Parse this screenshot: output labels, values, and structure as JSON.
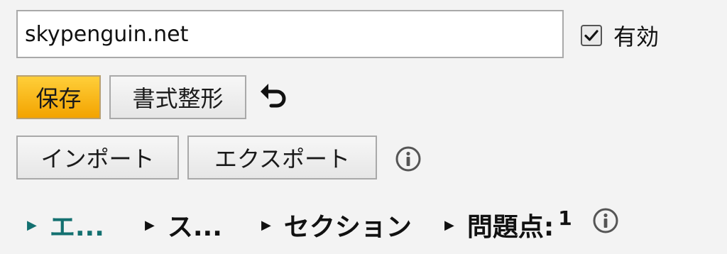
{
  "url_field": {
    "value": "skypenguin.net",
    "placeholder": ""
  },
  "enabled_checkbox": {
    "checked": true,
    "label": "有効"
  },
  "toolbar": {
    "save_label": "保存",
    "format_label": "書式整形",
    "undo_icon": "undo-icon"
  },
  "io": {
    "import_label": "インポート",
    "export_label": "エクスポート",
    "info_icon": "info-icon"
  },
  "sections": [
    {
      "label": "エ...",
      "active": true
    },
    {
      "label": "ス...",
      "active": false
    },
    {
      "label": "セクション",
      "active": false
    },
    {
      "label": "問題点:",
      "count": "1",
      "active": false
    }
  ],
  "colors": {
    "save_button": "#f7b500",
    "active_section": "#137070",
    "background": "#f3f3f3"
  }
}
